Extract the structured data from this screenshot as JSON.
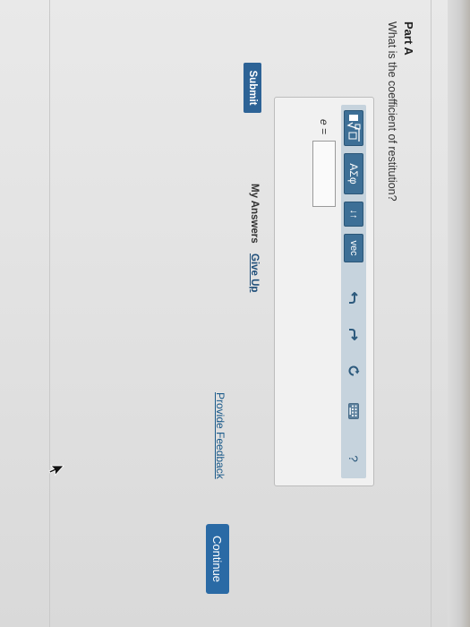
{
  "part": {
    "title": "Part A",
    "question": "What is the coefficient of restitution?"
  },
  "toolbar": {
    "buttons": [
      {
        "label": "",
        "icon": "template-sqrt-icon"
      },
      {
        "label": "ΑΣφ",
        "icon": "greek-symbols"
      },
      {
        "label": "↓↑",
        "icon": "subscript-superscript-icon"
      },
      {
        "label": "vec",
        "icon": "vector-icon"
      },
      {
        "label": "",
        "icon": "undo-icon"
      },
      {
        "label": "",
        "icon": "redo-icon"
      },
      {
        "label": "",
        "icon": "reset-icon"
      },
      {
        "label": "",
        "icon": "keyboard-icon"
      },
      {
        "label": "?",
        "icon": "help-icon"
      }
    ]
  },
  "answer": {
    "variable": "e =",
    "value": ""
  },
  "actions": {
    "submit": "Submit",
    "my_answers": "My Answers",
    "give_up": "Give Up"
  },
  "footer": {
    "feedback": "Provide Feedback",
    "continue": "Continue"
  },
  "colors": {
    "button_blue": "#2d6396",
    "toolbar_bg": "#c6d3dd",
    "link_blue": "#1a5a8a"
  }
}
